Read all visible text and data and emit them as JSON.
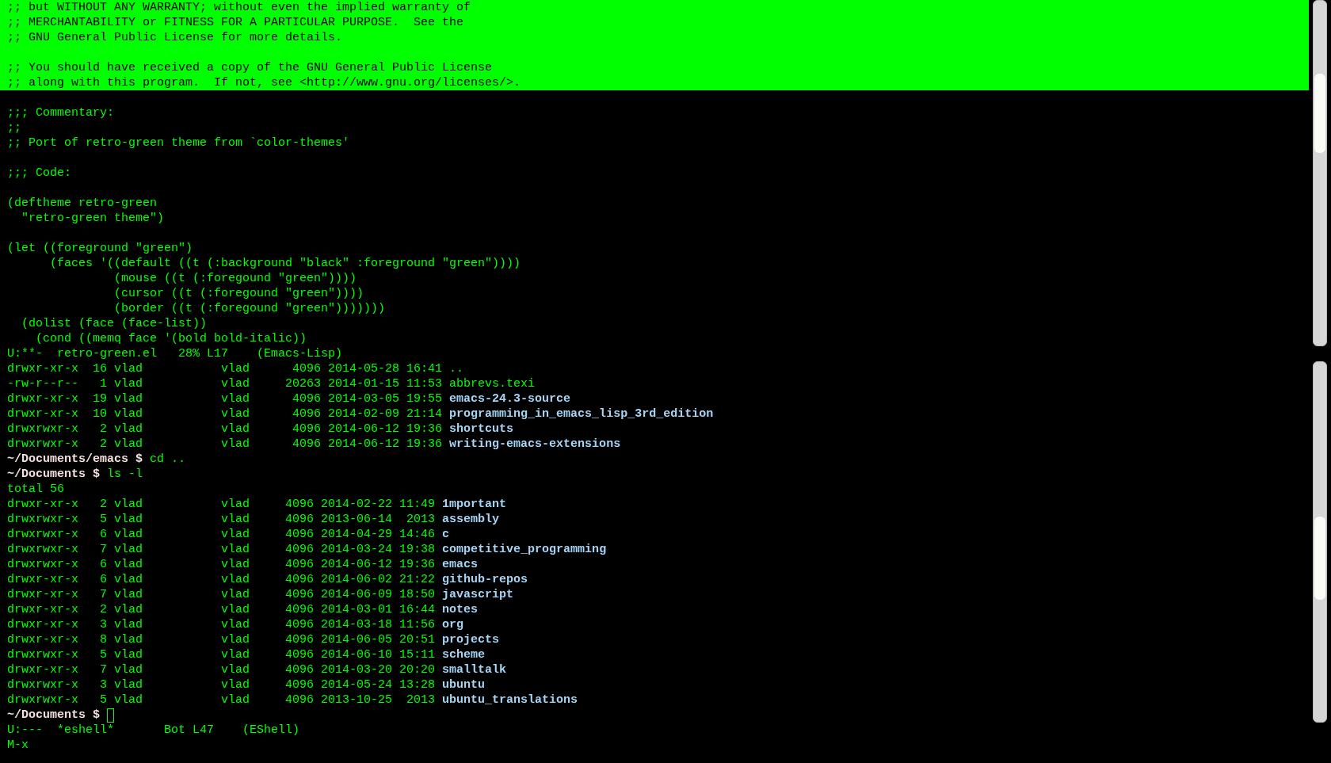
{
  "code_window": {
    "highlighted_paragraphs": [
      {
        "lines": [
          ";; but WITHOUT ANY WARRANTY; without even the implied warranty of",
          ";; MERCHANTABILITY or FITNESS FOR A PARTICULAR PURPOSE.  See the",
          ";; GNU General Public License for more details."
        ]
      },
      {
        "lines": [
          ";; You should have received a copy of the GNU General Public License",
          ";; along with this program.  If not, see <http://www.gnu.org/licenses/>."
        ]
      }
    ],
    "paragraphs": [
      {
        "lines": [
          ";;; Commentary:",
          ";;",
          ";; Port of retro-green theme from `color-themes'"
        ]
      },
      {
        "lines": [
          ";;; Code:"
        ]
      },
      {
        "lines": [
          "(deftheme retro-green",
          "  \"retro-green theme\")"
        ]
      },
      {
        "lines": [
          "(let ((foreground \"green\")",
          "      (faces '((default ((t (:background \"black\" :foreground \"green\"))))",
          "               (mouse ((t (:foregound \"green\"))))",
          "               (cursor ((t (:foregound \"green\"))))",
          "               (border ((t (:foregound \"green\")))))))",
          "  (dolist (face (face-list))",
          "    (cond ((memq face '(bold bold-italic))"
        ]
      }
    ],
    "mode_line": "U:**-  retro-green.el   28% L17    (Emacs-Lisp)"
  },
  "eshell_window": {
    "lines": [
      {
        "kind": "entry",
        "columns": "drwxr-xr-x  16 vlad           vlad      4096 2014-05-28 16:41",
        "name": "..",
        "directory": false
      },
      {
        "kind": "entry",
        "columns": "-rw-r--r--   1 vlad           vlad     20263 2014-01-15 11:53",
        "name": "abbrevs.texi",
        "directory": false
      },
      {
        "kind": "entry",
        "columns": "drwxr-xr-x  19 vlad           vlad      4096 2014-03-05 19:55",
        "name": "emacs-24.3-source",
        "directory": true
      },
      {
        "kind": "entry",
        "columns": "drwxr-xr-x  10 vlad           vlad      4096 2014-02-09 21:14",
        "name": "programming_in_emacs_lisp_3rd_edition",
        "directory": true
      },
      {
        "kind": "entry",
        "columns": "drwxrwxr-x   2 vlad           vlad      4096 2014-06-12 19:36",
        "name": "shortcuts",
        "directory": true
      },
      {
        "kind": "entry",
        "columns": "drwxrwxr-x   2 vlad           vlad      4096 2014-06-12 19:36",
        "name": "writing-emacs-extensions",
        "directory": true
      },
      {
        "kind": "prompt",
        "prompt": "~/Documents/emacs $",
        "command": "cd .."
      },
      {
        "kind": "prompt",
        "prompt": "~/Documents $",
        "command": "ls -l"
      },
      {
        "kind": "output",
        "text": "total 56"
      },
      {
        "kind": "entry",
        "columns": "drwxr-xr-x   2 vlad           vlad     4096 2014-02-22 11:49",
        "name": "1mportant",
        "directory": true
      },
      {
        "kind": "entry",
        "columns": "drwxrwxr-x   5 vlad           vlad     4096 2013-06-14  2013",
        "name": "assembly",
        "directory": true
      },
      {
        "kind": "entry",
        "columns": "drwxrwxr-x   6 vlad           vlad     4096 2014-04-29 14:46",
        "name": "c",
        "directory": true
      },
      {
        "kind": "entry",
        "columns": "drwxrwxr-x   7 vlad           vlad     4096 2014-03-24 19:38",
        "name": "competitive_programming",
        "directory": true
      },
      {
        "kind": "entry",
        "columns": "drwxrwxr-x   6 vlad           vlad     4096 2014-06-12 19:36",
        "name": "emacs",
        "directory": true
      },
      {
        "kind": "entry",
        "columns": "drwxr-xr-x   6 vlad           vlad     4096 2014-06-02 21:22",
        "name": "github-repos",
        "directory": true
      },
      {
        "kind": "entry",
        "columns": "drwxr-xr-x   7 vlad           vlad     4096 2014-06-09 18:50",
        "name": "javascript",
        "directory": true
      },
      {
        "kind": "entry",
        "columns": "drwxr-xr-x   2 vlad           vlad     4096 2014-03-01 16:44",
        "name": "notes",
        "directory": true
      },
      {
        "kind": "entry",
        "columns": "drwxr-xr-x   3 vlad           vlad     4096 2014-03-18 11:56",
        "name": "org",
        "directory": true
      },
      {
        "kind": "entry",
        "columns": "drwxr-xr-x   8 vlad           vlad     4096 2014-06-05 20:51",
        "name": "projects",
        "directory": true
      },
      {
        "kind": "entry",
        "columns": "drwxrwxr-x   5 vlad           vlad     4096 2014-06-10 15:11",
        "name": "scheme",
        "directory": true
      },
      {
        "kind": "entry",
        "columns": "drwxr-xr-x   7 vlad           vlad     4096 2014-03-20 20:20",
        "name": "smalltalk",
        "directory": true
      },
      {
        "kind": "entry",
        "columns": "drwxrwxr-x   3 vlad           vlad     4096 2014-05-24 13:28",
        "name": "ubuntu",
        "directory": true
      },
      {
        "kind": "entry",
        "columns": "drwxrwxr-x   5 vlad           vlad     4096 2013-10-25  2013",
        "name": "ubuntu_translations",
        "directory": true
      },
      {
        "kind": "prompt",
        "prompt": "~/Documents $",
        "cursor": true
      }
    ],
    "mode_line": "U:---  *eshell*       Bot L47    (EShell)"
  },
  "minibuffer": "M-x"
}
